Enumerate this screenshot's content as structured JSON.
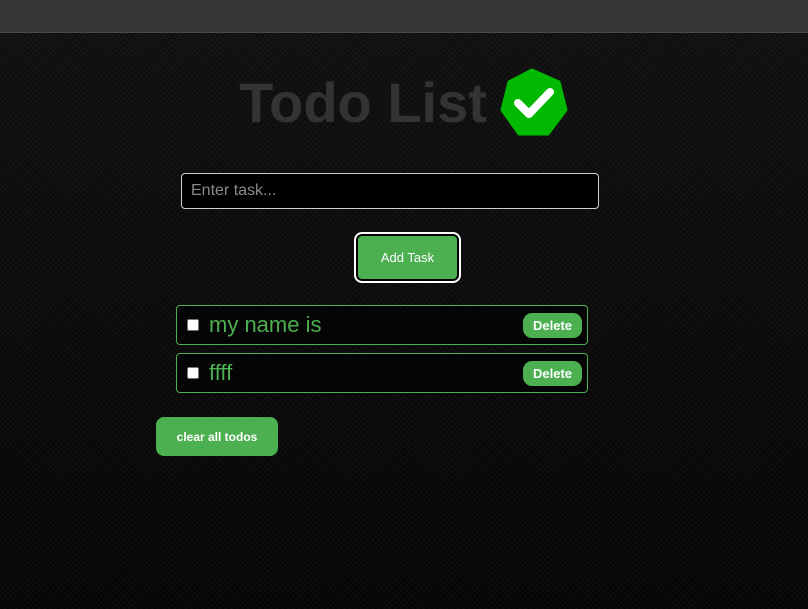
{
  "app": {
    "title": "Todo List",
    "logo_icon": "green-check-badge-icon",
    "accent_color": "#4caf50"
  },
  "input": {
    "placeholder": "Enter task...",
    "value": ""
  },
  "actions": {
    "add_label": "Add Task",
    "clear_label": "clear all todos"
  },
  "todos": [
    {
      "text": "my name is",
      "checked": false,
      "delete_label": "Delete"
    },
    {
      "text": "ffff",
      "checked": false,
      "delete_label": "Delete"
    }
  ]
}
